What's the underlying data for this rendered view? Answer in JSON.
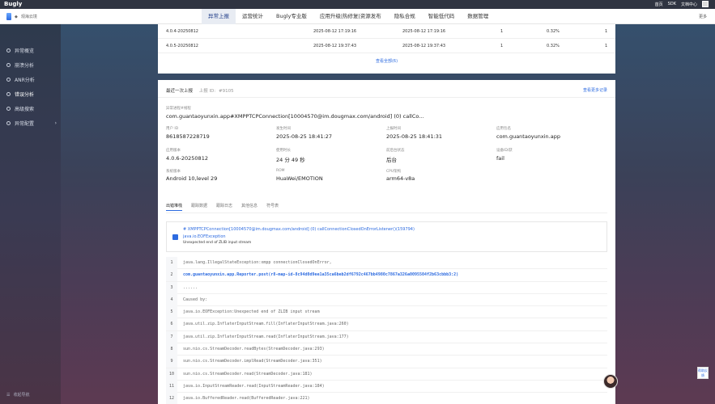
{
  "topbar": {
    "logo": "Bugly",
    "links": [
      "首页",
      "SDK",
      "文档中心"
    ]
  },
  "navbar": {
    "app_name": "观海云境",
    "tabs": [
      {
        "label": "异常上报",
        "active": true
      },
      {
        "label": "运营统计",
        "active": false
      },
      {
        "label": "Bugly专业版",
        "active": false
      },
      {
        "label": "应用升级|热修复|资源发布",
        "active": false
      },
      {
        "label": "隐私合规",
        "active": false
      },
      {
        "label": "智能低代码",
        "active": false
      },
      {
        "label": "数据管理",
        "active": false
      }
    ],
    "more": "更多"
  },
  "sidebar": {
    "items": [
      {
        "label": "异常概览",
        "active": false
      },
      {
        "label": "崩溃分析",
        "active": false
      },
      {
        "label": "ANR分析",
        "active": false
      },
      {
        "label": "错误分析",
        "active": true
      },
      {
        "label": "高级搜索",
        "active": false
      },
      {
        "label": "异常配置",
        "active": false,
        "has_arrow": true
      }
    ],
    "bottom": "收起导航"
  },
  "versions": {
    "rows": [
      {
        "version": "4.0.4-20250812",
        "first": "2025-08-12 17:19:16",
        "last": "2025-08-12 17:19:16",
        "count": "1",
        "pct": "0.32%",
        "users": "1"
      },
      {
        "version": "4.0.5-20250812",
        "first": "2025-08-12 19:37:43",
        "last": "2025-08-12 19:37:43",
        "count": "1",
        "pct": "0.32%",
        "users": "1"
      }
    ],
    "view_all": "查看全部(6)"
  },
  "report": {
    "title": "最近一次上报",
    "report_id_label": "上报 ID:",
    "report_id": "#9105",
    "more": "查看更多记录",
    "exception_label": "异常进程#线程",
    "exception_value": "com.guantaoyunxin.app#XMPPTCPConnection[10004570@im.dougmax.com/android] (0) callCo...",
    "fields": [
      {
        "label": "用户 ID",
        "value": "8618587228719"
      },
      {
        "label": "发生时间",
        "value": "2025-08-25 18:41:27"
      },
      {
        "label": "上报时间",
        "value": "2025-08-25 18:41:31"
      },
      {
        "label": "应用包名",
        "value": "com.guantaoyunxin.app"
      },
      {
        "label": "应用版本",
        "value": "4.0.6-20250812"
      },
      {
        "label": "使用时长",
        "value": "24 分 49 秒"
      },
      {
        "label": "前后台状态",
        "value": "后台"
      },
      {
        "label": "设备ID/获",
        "value": "fail"
      },
      {
        "label": "系统版本",
        "value": "Android 10,level 29"
      },
      {
        "label": "ROM",
        "value": "HuaWei/EMOTION"
      },
      {
        "label": "CPU架构",
        "value": "arm64-v8a"
      }
    ],
    "tabs": [
      {
        "label": "出错堆栈",
        "active": true
      },
      {
        "label": "跟踪数据",
        "active": false
      },
      {
        "label": "跟踪日志",
        "active": false
      },
      {
        "label": "其他信息",
        "active": false
      },
      {
        "label": "符号表",
        "active": false
      }
    ],
    "trace_head": {
      "line1": "# XMPPTCPConnection[10004570@im.dougmax.com/android] (0) callConnectionClosedOnErrorListener()(159794)",
      "line2": "java.io.EOFException",
      "line3": "Unexpected end of ZLIB input stream"
    },
    "code_lines": [
      {
        "n": "1",
        "text": "java.lang.IllegalStateException:xmpp connectionClosedOnError,",
        "hl": false
      },
      {
        "n": "2",
        "text": "com.guantaoyunxin.app.Reporter.post(r8-map-id-8c94d0d9ee1a35ca6beb2df6792c467bb4980c7867a326a0095504f2b63cbbb3:2)",
        "hl": true
      },
      {
        "n": "3",
        "text": "......",
        "hl": false
      },
      {
        "n": "4",
        "text": "Caused by:",
        "hl": false
      },
      {
        "n": "5",
        "text": "java.io.EOFException:Unexpected end of ZLIB input stream",
        "hl": false
      },
      {
        "n": "6",
        "text": "java.util.zip.InflaterInputStream.fill(InflaterInputStream.java:260)",
        "hl": false
      },
      {
        "n": "7",
        "text": "java.util.zip.InflaterInputStream.read(InflaterInputStream.java:177)",
        "hl": false
      },
      {
        "n": "8",
        "text": "sun.nio.cs.StreamDecoder.readBytes(StreamDecoder.java:293)",
        "hl": false
      },
      {
        "n": "9",
        "text": "sun.nio.cs.StreamDecoder.implRead(StreamDecoder.java:351)",
        "hl": false
      },
      {
        "n": "10",
        "text": "sun.nio.cs.StreamDecoder.read(StreamDecoder.java:181)",
        "hl": false
      },
      {
        "n": "11",
        "text": "java.io.InputStreamReader.read(InputStreamReader.java:184)",
        "hl": false
      },
      {
        "n": "12",
        "text": "java.io.BufferedReader.read(BufferedReader.java:221)",
        "hl": false
      }
    ]
  },
  "float_button": "帮助反馈",
  "colors": {
    "accent": "#2d6be0",
    "topbar": "#2f3441"
  }
}
